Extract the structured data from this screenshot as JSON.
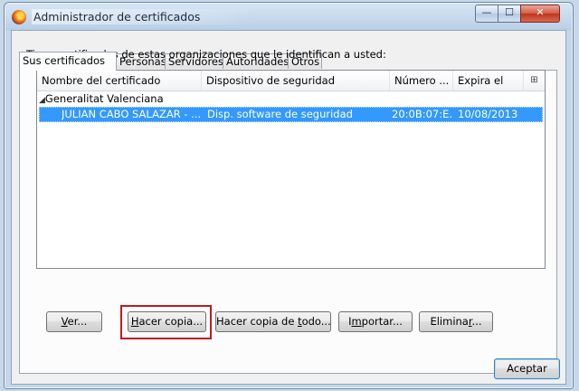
{
  "window": {
    "title": "Administrador de certificados",
    "controls": {
      "minimize": "—",
      "maximize": "☐",
      "close": "✕"
    }
  },
  "tabs": [
    {
      "label": "Sus certificados",
      "active": true
    },
    {
      "label": "Personas",
      "active": false
    },
    {
      "label": "Servidores",
      "active": false
    },
    {
      "label": "Autoridades",
      "active": false
    },
    {
      "label": "Otros",
      "active": false
    }
  ],
  "intro_text": "Tiene certificados de estas organizaciones que le identifican a usted:",
  "table": {
    "columns": [
      "Nombre del certificado",
      "Dispositivo de seguridad",
      "Número ...",
      "Expira el"
    ],
    "column_picker_glyph": "⊞",
    "groups": [
      {
        "name": "Generalitat Valenciana",
        "expanded_glyph": "◢",
        "rows": [
          {
            "name": "JULIAN CABO SALAZAR - ...",
            "device": "Disp. software de seguridad",
            "number": "20:0B:07:E...",
            "expires": "10/08/2013",
            "selected": true
          }
        ]
      }
    ]
  },
  "buttons": {
    "view": {
      "pre": "",
      "accel": "V",
      "post": "er..."
    },
    "backup": {
      "pre": "",
      "accel": "H",
      "post": "acer copia..."
    },
    "backup_all": {
      "pre": "Hacer copia de ",
      "accel": "t",
      "post": "odo..."
    },
    "import": {
      "pre": "I",
      "accel": "m",
      "post": "portar..."
    },
    "delete": {
      "pre": "Elimina",
      "accel": "r",
      "post": "..."
    },
    "ok": "Aceptar"
  },
  "colors": {
    "selection": "#3399ff",
    "highlight_box": "#c01922"
  }
}
